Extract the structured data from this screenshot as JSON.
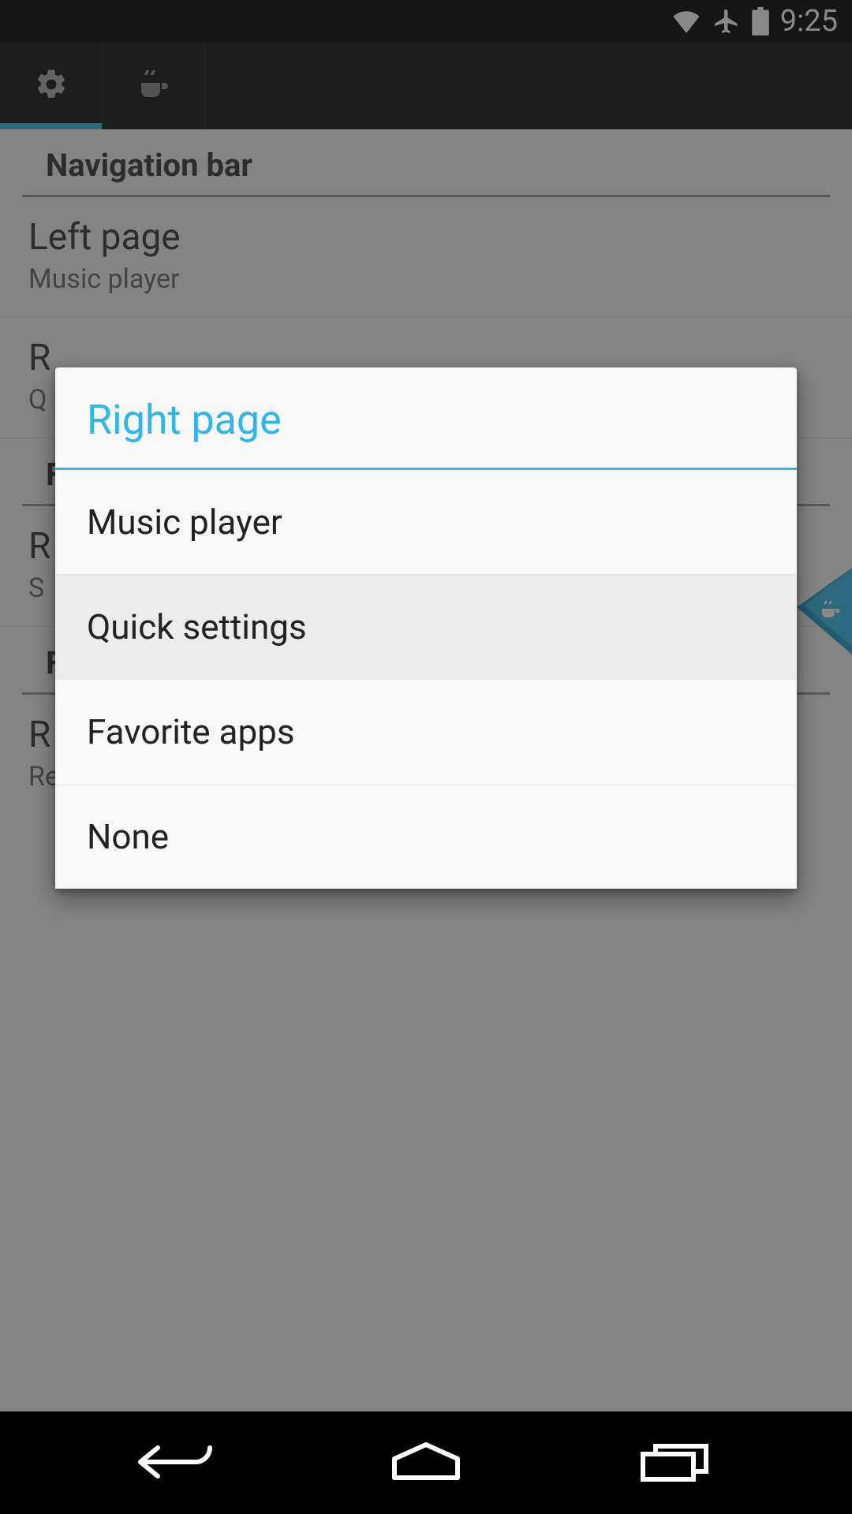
{
  "status": {
    "time": "9:25"
  },
  "tabs": {
    "active_index": 0
  },
  "sections": {
    "nav_header": "Navigation bar",
    "left_page": {
      "title": "Left page",
      "value": "Music player"
    },
    "right_page_prefix": "R",
    "right_page_value_prefix": "Q",
    "second_header_prefix": "F",
    "item3_title_prefix": "R",
    "item3_value_prefix": "S",
    "third_header_prefix": "F",
    "item4_title_prefix": "R",
    "item4_value": "Requires Root"
  },
  "dialog": {
    "title": "Right page",
    "options": [
      {
        "label": "Music player",
        "selected": false
      },
      {
        "label": "Quick settings",
        "selected": true
      },
      {
        "label": "Favorite apps",
        "selected": false
      },
      {
        "label": "None",
        "selected": false
      }
    ]
  },
  "colors": {
    "accent": "#33b5e5"
  }
}
